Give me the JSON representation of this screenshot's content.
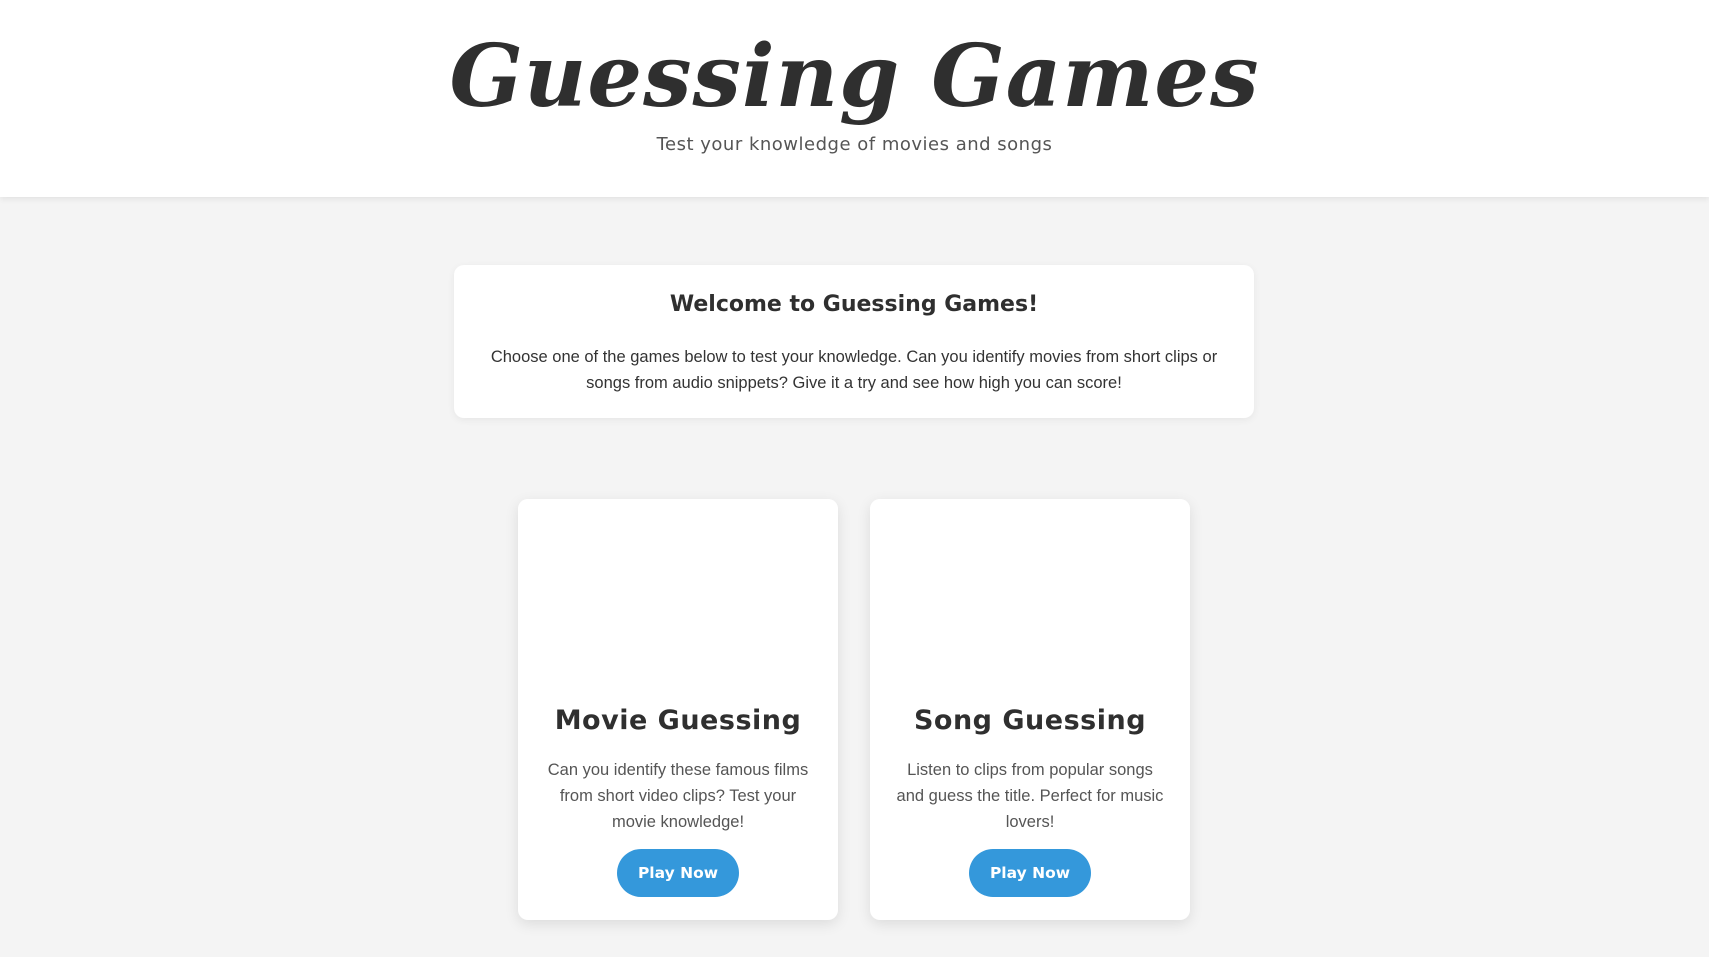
{
  "header": {
    "title": "Guessing Games",
    "subtitle": "Test your knowledge of movies and songs"
  },
  "welcome": {
    "title": "Welcome to Guessing Games!",
    "text": "Choose one of the games below to test your knowledge. Can you identify movies from short clips or songs from audio snippets? Give it a try and see how high you can score!"
  },
  "games": [
    {
      "title": "Movie Guessing",
      "description": "Can you identify these famous films from short video clips? Test your movie knowledge!",
      "button_label": "Play Now"
    },
    {
      "title": "Song Guessing",
      "description": "Listen to clips from popular songs and guess the title. Perfect for music lovers!",
      "button_label": "Play Now"
    }
  ],
  "colors": {
    "accent": "#3498db",
    "background": "#f4f4f4",
    "card": "#ffffff",
    "text": "#333333"
  }
}
